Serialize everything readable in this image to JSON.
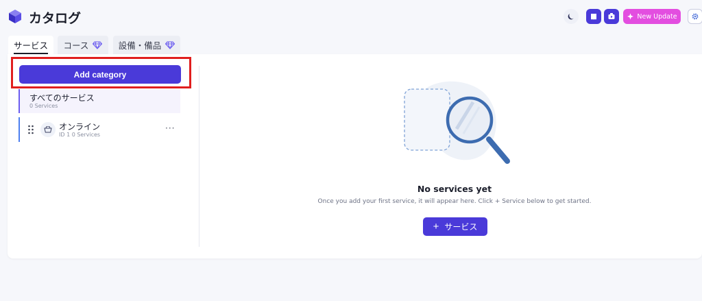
{
  "header": {
    "title": "カタログ",
    "new_update_label": "New Update",
    "icons": [
      "cube-logo-icon",
      "moon-icon",
      "book-icon",
      "video-icon",
      "sparkle-icon",
      "gear-icon"
    ]
  },
  "tabs": [
    {
      "label": "サービス",
      "active": true
    },
    {
      "label": "コース",
      "premium": true
    },
    {
      "label": "設備・備品",
      "premium": true
    }
  ],
  "sidebar": {
    "add_category_label": "Add category",
    "categories": [
      {
        "name": "すべてのサービス",
        "sub": "0 Services"
      },
      {
        "name": "オンライン",
        "sub": "ID 1   0 Services",
        "more": "···"
      }
    ]
  },
  "empty_state": {
    "title": "No services yet",
    "description": "Once you add your first service, it will appear here. Click + Service below to get started.",
    "button_label": "サービス",
    "button_plus": "+"
  },
  "colors": {
    "accent": "#4a3ad9",
    "update": "#e34ee0",
    "highlight": "#e01e1e",
    "premium": "#6b5cf0"
  }
}
